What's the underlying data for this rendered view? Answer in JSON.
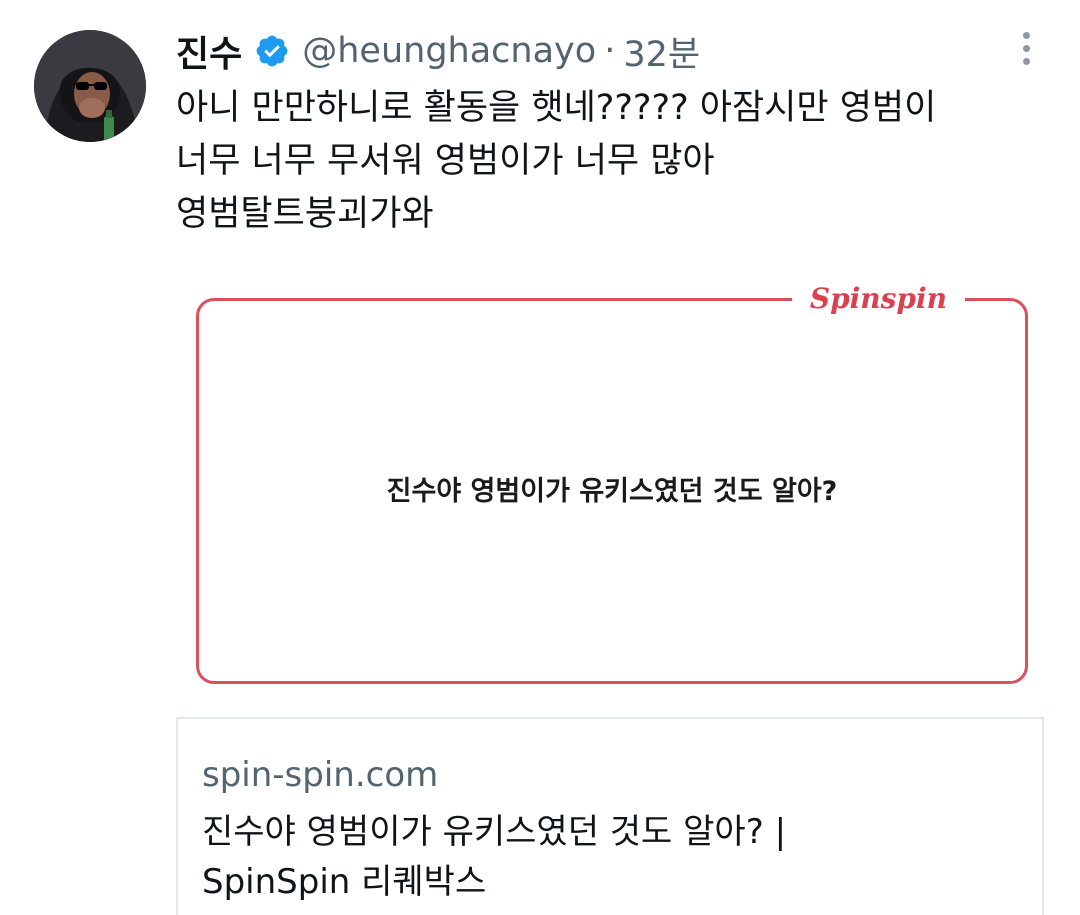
{
  "tweet": {
    "author": {
      "display_name": "진수",
      "handle": "@heunghacnayo",
      "verified": true,
      "avatar_icon": "avatar-sunglasses-icon"
    },
    "separator": "·",
    "timestamp": "32분",
    "text_lines": [
      "아니 만만하니로 활동을 햇네????? 아잠시만 영범이",
      "너무 너무 무서워 영범이가 너무 많아",
      "영범탈트붕괴가와"
    ],
    "media": {
      "logo_text": "Spinspin",
      "caption": "진수야 영범이가 유키스였던 것도 알아?",
      "accent_color": "#d9515b"
    },
    "link_card": {
      "domain": "spin-spin.com",
      "title_lines": [
        "진수야 영범이가 유키스였던 것도 알아? |",
        "SpinSpin 리퀘박스"
      ]
    }
  },
  "colors": {
    "text_primary": "#0f1419",
    "text_secondary": "#536471",
    "verified_blue": "#1d9bf0"
  }
}
